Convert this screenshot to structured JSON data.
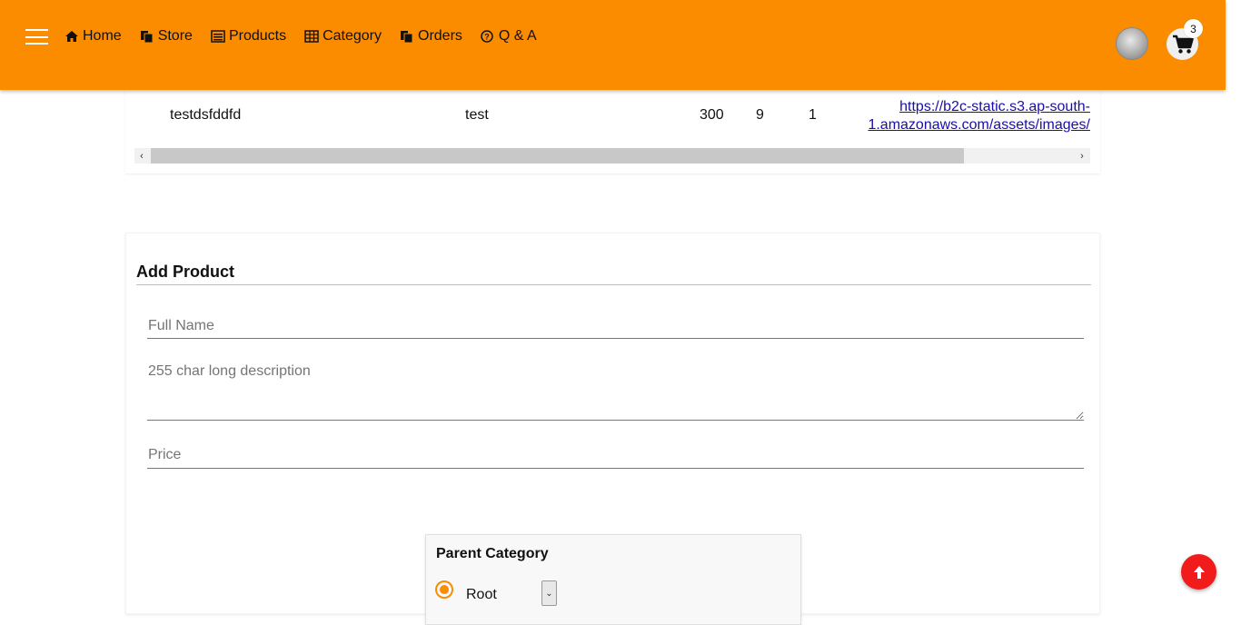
{
  "header": {
    "bg_color": "#fb8c00",
    "menu_icon": "hamburger-icon",
    "nav": [
      {
        "label": "Home",
        "icon": "home-icon"
      },
      {
        "label": "Store",
        "icon": "copy-icon"
      },
      {
        "label": "Products",
        "icon": "list-alt-icon"
      },
      {
        "label": "Category",
        "icon": "table-icon"
      },
      {
        "label": "Orders",
        "icon": "copy-icon"
      },
      {
        "label": "Q & A",
        "icon": "question-circle-icon"
      }
    ],
    "cart_count": "3"
  },
  "table_row": {
    "name": "testdsfddfd",
    "description": "test",
    "price": "300",
    "quantity": "9",
    "category": "1",
    "image_url_line1": "https://b2c-static.s3.ap-south-",
    "image_url_line2": "1.amazonaws.com/assets/images/"
  },
  "form": {
    "title": "Add Product",
    "full_name_placeholder": "Full Name",
    "description_placeholder": "255 char long description",
    "price_placeholder": "Price",
    "parent_category_title": "Parent Category",
    "root_label": "Root"
  },
  "colors": {
    "accent": "#fb8c00",
    "scroll_top_button": "#f21b1b",
    "link": "#1a0dab"
  }
}
